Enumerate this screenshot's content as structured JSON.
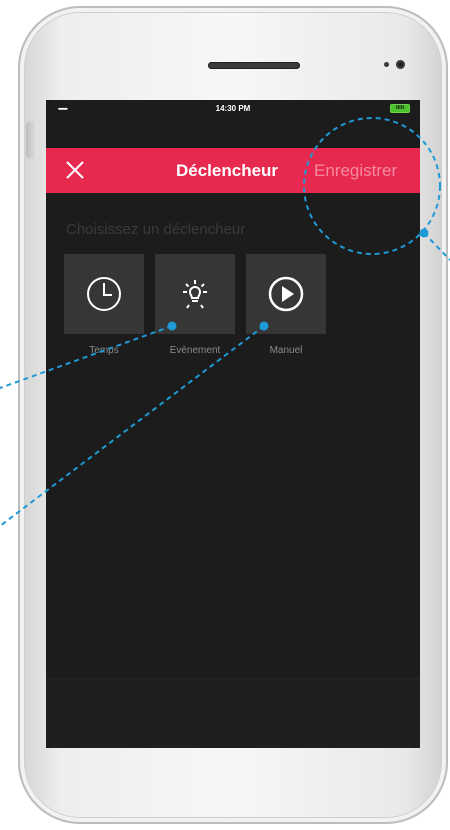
{
  "status_bar": {
    "signal": "▪▪▪▪▪▪",
    "time": "14:30 PM",
    "battery": "IIIII"
  },
  "header": {
    "close_icon": "close-icon",
    "title": "Déclencheur",
    "save_label": "Enregistrer"
  },
  "main": {
    "section_title": "Choisissez un déclencheur",
    "triggers": [
      {
        "label": "Temps",
        "icon": "clock-icon"
      },
      {
        "label": "Evènement",
        "icon": "light-bulb-icon"
      },
      {
        "label": "Manuel",
        "icon": "play-icon"
      }
    ]
  },
  "colors": {
    "accent": "#e8294f",
    "save_disabled": "#f48aa0",
    "screen_bg": "#1c1c1c",
    "tile_bg": "#363636",
    "annotation": "#1e9ad6"
  }
}
